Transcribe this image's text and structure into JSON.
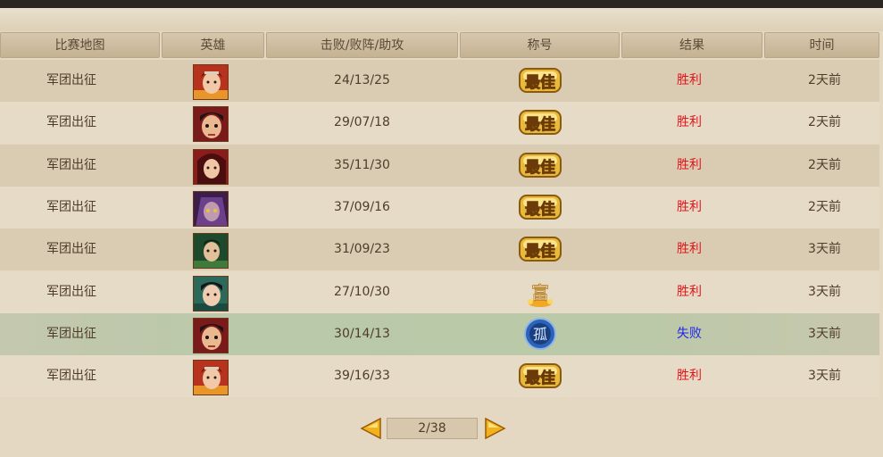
{
  "header": {
    "map": "比赛地图",
    "hero": "英雄",
    "kda": "击败/败阵/助攻",
    "title": "称号",
    "result": "结果",
    "time": "时间"
  },
  "rows": [
    {
      "map": "军团出征",
      "kda": "24/13/25",
      "badge": "最佳",
      "result": "胜利",
      "time": "2天前",
      "outcome": "win",
      "hero_icon": "hero-portrait-1"
    },
    {
      "map": "军团出征",
      "kda": "29/07/18",
      "badge": "最佳",
      "result": "胜利",
      "time": "2天前",
      "outcome": "win",
      "hero_icon": "hero-portrait-2"
    },
    {
      "map": "军团出征",
      "kda": "35/11/30",
      "badge": "最佳",
      "result": "胜利",
      "time": "2天前",
      "outcome": "win",
      "hero_icon": "hero-portrait-3"
    },
    {
      "map": "军团出征",
      "kda": "37/09/16",
      "badge": "最佳",
      "result": "胜利",
      "time": "2天前",
      "outcome": "win",
      "hero_icon": "hero-portrait-4"
    },
    {
      "map": "军团出征",
      "kda": "31/09/23",
      "badge": "最佳",
      "result": "胜利",
      "time": "3天前",
      "outcome": "win",
      "hero_icon": "hero-portrait-5"
    },
    {
      "map": "军团出征",
      "kda": "27/10/30",
      "badge": "富",
      "result": "胜利",
      "time": "3天前",
      "outcome": "win",
      "hero_icon": "hero-portrait-6"
    },
    {
      "map": "军团出征",
      "kda": "30/14/13",
      "badge": "孤",
      "result": "失败",
      "time": "3天前",
      "outcome": "loss",
      "hero_icon": "hero-portrait-2"
    },
    {
      "map": "军团出征",
      "kda": "39/16/33",
      "badge": "最佳",
      "result": "胜利",
      "time": "3天前",
      "outcome": "win",
      "hero_icon": "hero-portrait-1"
    }
  ],
  "pager": {
    "text": "2/38"
  },
  "colors": {
    "win": "#e4141a",
    "loss": "#1f25e6",
    "gold": "#e8b93a"
  }
}
